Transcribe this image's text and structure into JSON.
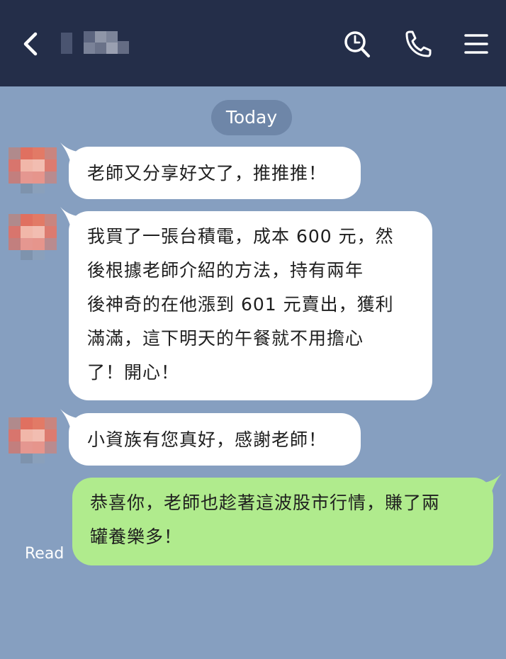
{
  "header": {
    "back": "back",
    "search_icon": "search-icon",
    "call_icon": "phone-icon",
    "menu_icon": "menu-icon",
    "background": "#242e49"
  },
  "chat": {
    "date_label": "Today",
    "background": "#869fc0",
    "messages": [
      {
        "direction": "incoming",
        "lines": [
          "老師又分享好文了，推推推！"
        ]
      },
      {
        "direction": "incoming",
        "lines": [
          "我買了一張台積電，成本 600 元，然",
          "後根據老師介紹的方法，持有兩年",
          "後神奇的在他漲到 601 元賣出，獲利",
          "滿滿，這下明天的午餐就不用擔心",
          "了！開心！"
        ]
      },
      {
        "direction": "incoming",
        "lines": [
          "小資族有您真好，感謝老師！"
        ]
      },
      {
        "direction": "outgoing",
        "lines": [
          "恭喜你，老師也趁著這波股市行情，賺了兩",
          "罐養樂多！"
        ],
        "status": "Read"
      }
    ],
    "colors": {
      "incoming_bubble": "#ffffff",
      "outgoing_bubble": "#b0eb8d",
      "date_pill": "#6e86a8"
    }
  }
}
